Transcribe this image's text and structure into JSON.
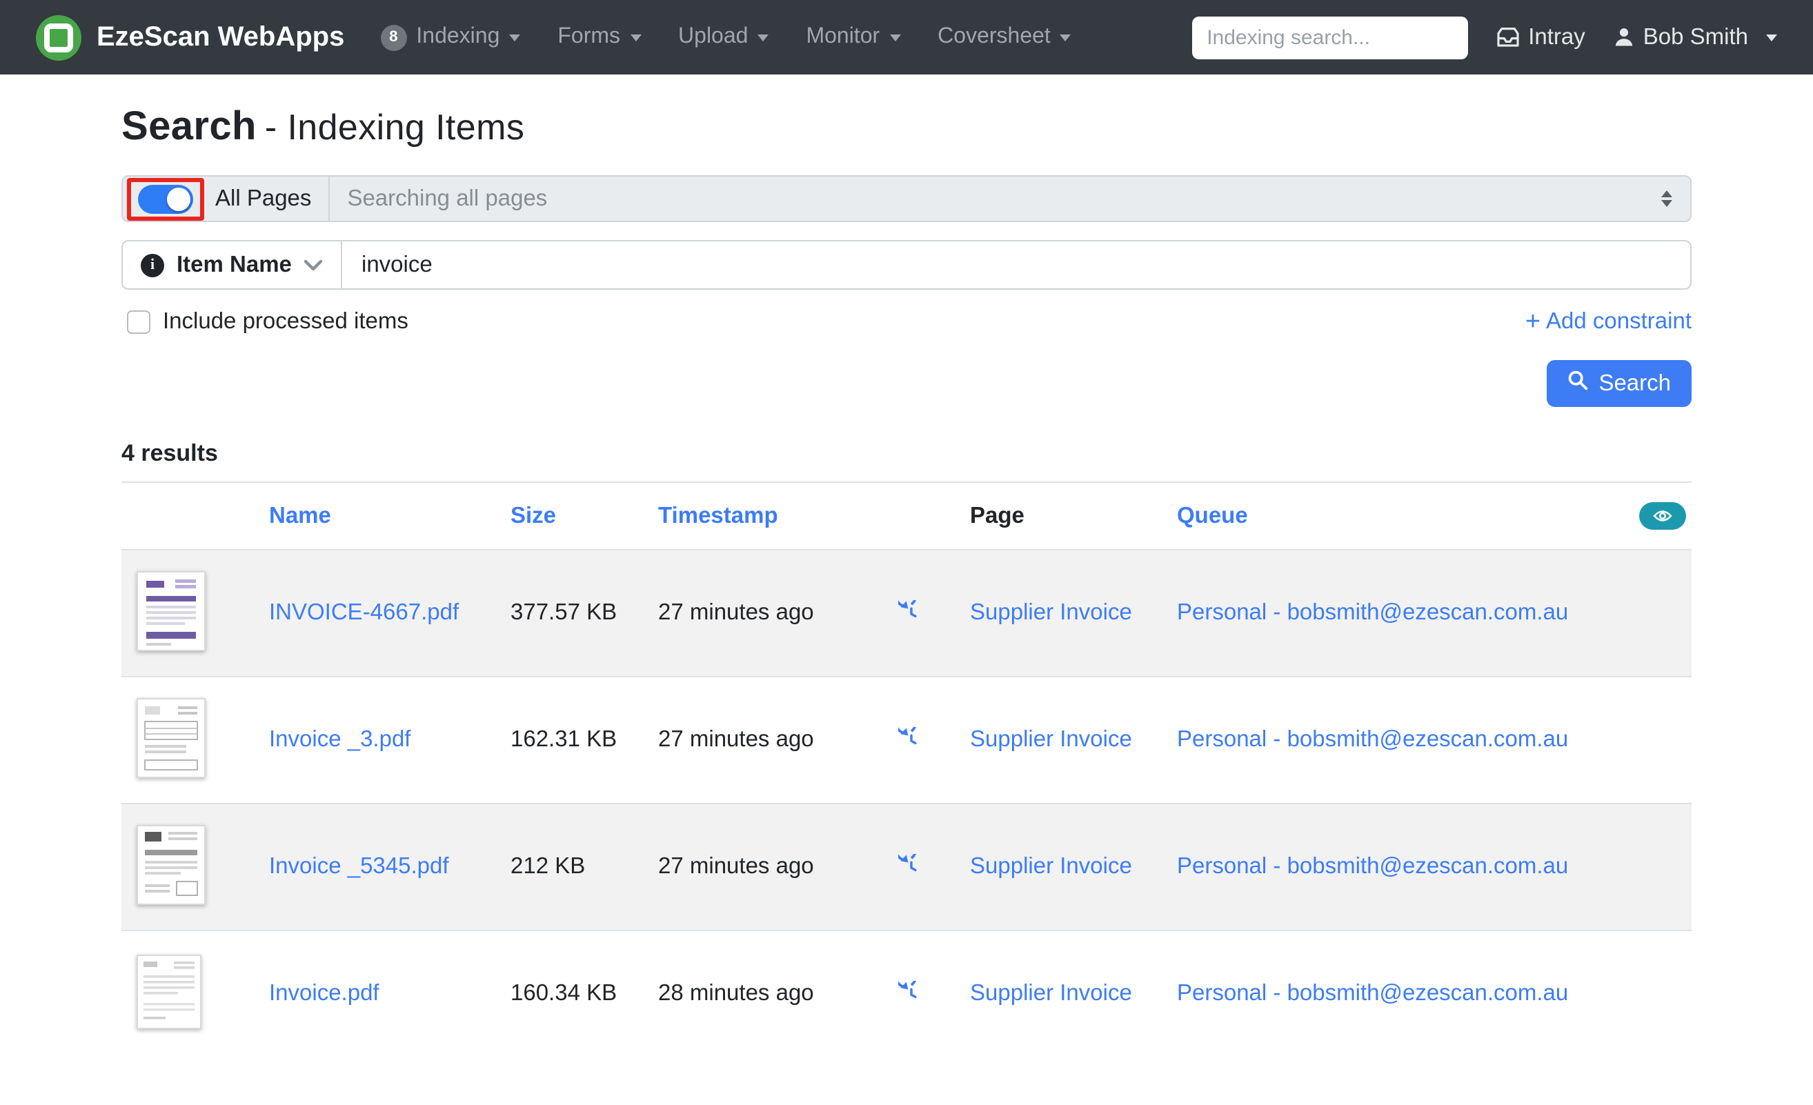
{
  "colors": {
    "navbar_bg": "#343a40",
    "accent_blue": "#3d7cf4",
    "toggle_blue": "#2e7cf6",
    "teal_eye": "#1d99ae",
    "annotation_red": "#e8251f",
    "logo_green": "#48a548",
    "stripe_gray": "#f2f2f2"
  },
  "navbar": {
    "brand": "EzeScan WebApps",
    "items": [
      {
        "label": "Indexing",
        "badge": "8"
      },
      {
        "label": "Forms"
      },
      {
        "label": "Upload"
      },
      {
        "label": "Monitor"
      },
      {
        "label": "Coversheet"
      }
    ],
    "search_placeholder": "Indexing search...",
    "intray_label": "Intray",
    "user_label": "Bob Smith"
  },
  "page": {
    "title": "Search",
    "subtitle": "- Indexing Items"
  },
  "filters": {
    "all_pages_label": "All Pages",
    "all_pages_value": "Searching all pages",
    "all_pages_toggle_on": true,
    "field_name": "Item Name",
    "field_value": "invoice",
    "include_processed_label": "Include processed items",
    "include_processed_checked": false,
    "add_constraint_plus": "+",
    "add_constraint_label": "Add constraint",
    "search_button_label": "Search"
  },
  "results": {
    "count_label": "4 results",
    "columns": {
      "name": "Name",
      "size": "Size",
      "timestamp": "Timestamp",
      "page": "Page",
      "queue": "Queue"
    },
    "rows": [
      {
        "name": "INVOICE-4667.pdf",
        "size": "377.57 KB",
        "timestamp": "27 minutes ago",
        "page": "Supplier Invoice",
        "queue": "Personal - bobsmith@ezescan.com.au"
      },
      {
        "name": "Invoice _3.pdf",
        "size": "162.31 KB",
        "timestamp": "27 minutes ago",
        "page": "Supplier Invoice",
        "queue": "Personal - bobsmith@ezescan.com.au"
      },
      {
        "name": "Invoice _5345.pdf",
        "size": "212 KB",
        "timestamp": "27 minutes ago",
        "page": "Supplier Invoice",
        "queue": "Personal - bobsmith@ezescan.com.au"
      },
      {
        "name": "Invoice.pdf",
        "size": "160.34 KB",
        "timestamp": "28 minutes ago",
        "page": "Supplier Invoice",
        "queue": "Personal - bobsmith@ezescan.com.au"
      }
    ]
  }
}
